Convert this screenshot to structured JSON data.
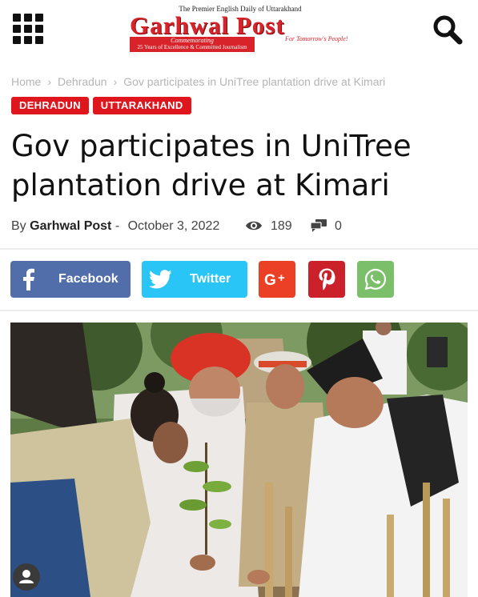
{
  "header": {
    "menu_icon": "grid-menu-icon",
    "search_icon": "search-icon",
    "logo": {
      "tagline": "The Premier English Daily of Uttarakhand",
      "name": "Garhwal Post",
      "slogan": "For Tomorrow's People!",
      "commemorating": "Commemorating",
      "anniversary": "25 Years of Excellence & Committed Journalism",
      "brand_color": "#d9232a"
    }
  },
  "breadcrumb": {
    "items": [
      "Home",
      "Dehradun",
      "Gov participates in UniTree plantation drive at Kimari"
    ],
    "separator": "›"
  },
  "tags": [
    "DEHRADUN",
    "UTTARAKHAND"
  ],
  "tag_color": "#e0161e",
  "article": {
    "title": "Gov participates in UniTree plantation drive at Kimari",
    "by": "By",
    "author": "Garhwal Post",
    "dash": "-",
    "date": "October 3, 2022",
    "views": "189",
    "comments": "0"
  },
  "share": {
    "facebook": {
      "label": "Facebook",
      "color": "#516eab",
      "icon": "facebook-icon"
    },
    "twitter": {
      "label": "Twitter",
      "color": "#29c5f6",
      "icon": "twitter-icon"
    },
    "googleplus": {
      "label": "",
      "color": "#eb4026",
      "icon": "google-plus-icon"
    },
    "pinterest": {
      "label": "",
      "color": "#ca212a",
      "icon": "pinterest-icon"
    },
    "whatsapp": {
      "label": "",
      "color": "#7bbf6a",
      "icon": "whatsapp-icon"
    }
  },
  "photo": {
    "icon": "article-photo"
  }
}
